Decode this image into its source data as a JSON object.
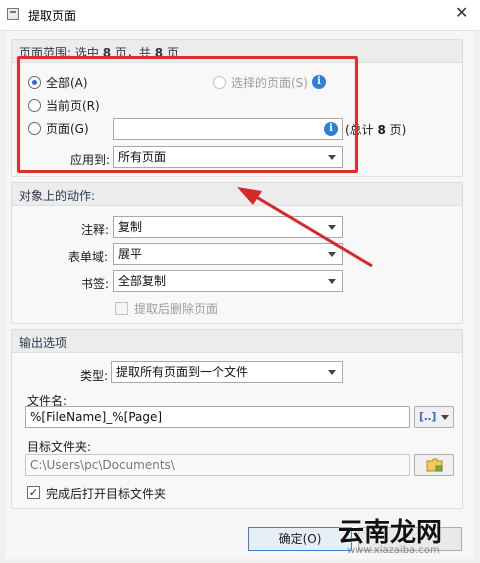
{
  "window": {
    "title": "提取页面",
    "close_glyph": "✕"
  },
  "page_range": {
    "title_prefix": "页面范围: 选中 ",
    "selected_count": "8",
    "title_middle": " 页，共 ",
    "total_count": "8",
    "title_suffix": " 页",
    "radio_all": "全部(A)",
    "radio_current": "当前页(R)",
    "radio_pages": "页面(G)",
    "radio_selected": "选择的页面(S)",
    "pages_value": "",
    "total_prefix": "(总计 ",
    "total_suffix": " 页)",
    "apply_label": "应用到:",
    "apply_value": "所有页面"
  },
  "actions": {
    "title": "对象上的动作:",
    "comment_label": "注释:",
    "comment_value": "复制",
    "form_label": "表单域:",
    "form_value": "展平",
    "bookmark_label": "书签:",
    "bookmark_value": "全部复制",
    "delete_after_label": "提取后删除页面"
  },
  "output": {
    "title": "输出选项",
    "type_label": "类型:",
    "type_value": "提取所有页面到一个文件",
    "filename_label": "文件名:",
    "filename_value": "%[FileName]_%[Page]",
    "folder_label": "目标文件夹:",
    "folder_value": "C:\\Users\\pc\\Documents\\",
    "open_after_label": "完成后打开目标文件夹"
  },
  "buttons": {
    "ok": "确定(O)"
  },
  "watermark": {
    "text": "云南龙网",
    "sub": "www.xiazaiba.com"
  },
  "colors": {
    "accent": "#2b6fd4",
    "highlight": "#e32b2b",
    "arrow": "#d62a2a",
    "info": "#2e7fd8"
  }
}
